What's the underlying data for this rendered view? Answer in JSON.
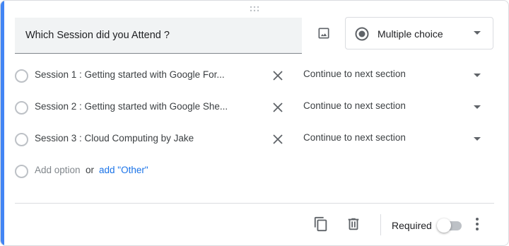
{
  "question": {
    "title": "Which Session did you Attend ?",
    "type_label": "Multiple choice",
    "icons": {
      "image": "image-icon",
      "type": "radio-checked-icon",
      "caret": "caret-down-icon"
    }
  },
  "options": [
    {
      "label": "Session 1 : Getting started with Google For...",
      "go_to": "Continue to next section"
    },
    {
      "label": "Session 2 : Getting started with Google She...",
      "go_to": "Continue to next section"
    },
    {
      "label": "Session 3 : Cloud Computing by Jake",
      "go_to": "Continue to next section"
    }
  ],
  "add_option": {
    "label": "Add option",
    "or": "or",
    "other_link": "add \"Other\""
  },
  "footer": {
    "required_label": "Required",
    "required": false,
    "icons": {
      "duplicate": "copy-icon",
      "delete": "trash-icon",
      "more": "more-vert-icon"
    }
  },
  "colors": {
    "accent": "#4285f4",
    "link": "#1a73e8"
  }
}
